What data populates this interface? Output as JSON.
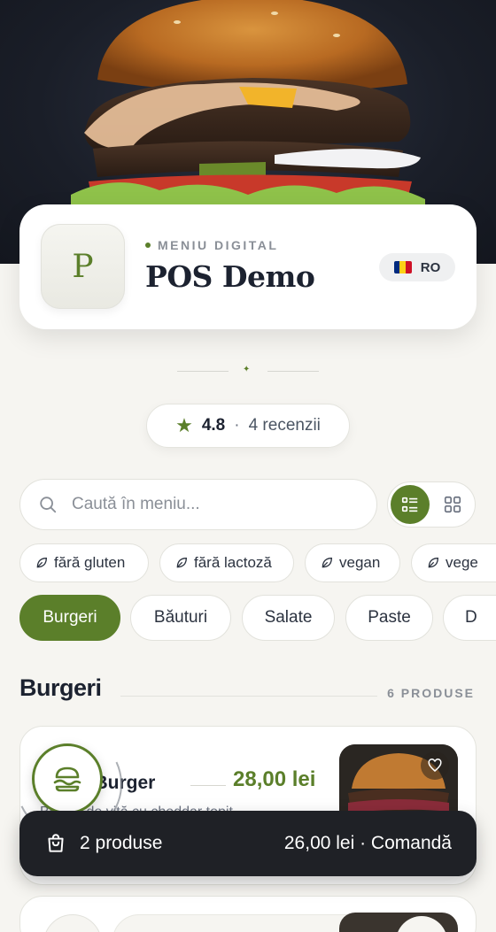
{
  "header": {
    "eyebrow": "MENIU DIGITAL",
    "title": "POS Demo",
    "logo_letter": "P",
    "language": "RO",
    "flag_colors": [
      "#002B7F",
      "#FCD116",
      "#CE1126"
    ]
  },
  "rating": {
    "value": "4.8",
    "separator": "·",
    "reviews": "4 recenzii"
  },
  "search": {
    "placeholder": "Caută în meniu..."
  },
  "filters": [
    {
      "label": "fără gluten",
      "icon": "leaf-icon"
    },
    {
      "label": "fără lactoză",
      "icon": "leaf-icon"
    },
    {
      "label": "vegan",
      "icon": "leaf-icon"
    },
    {
      "label": "vege",
      "icon": "leaf-icon"
    }
  ],
  "categories": [
    {
      "label": "Burgeri",
      "active": true
    },
    {
      "label": "Băuturi",
      "active": false
    },
    {
      "label": "Salate",
      "active": false
    },
    {
      "label": "Paste",
      "active": false
    },
    {
      "label": "D",
      "active": false
    }
  ],
  "section": {
    "title": "Burgeri",
    "count": "6 PRODUSE"
  },
  "product": {
    "name": "e Burger",
    "price": "28,00 lei",
    "description": "Burger de vită cu cheddar topit"
  },
  "cart": {
    "items": "2 produse",
    "summary": "26,00 lei · Comandă"
  },
  "colors": {
    "accent": "#5b7f2a",
    "background": "#f6f5f1",
    "dark": "#1f2126"
  }
}
